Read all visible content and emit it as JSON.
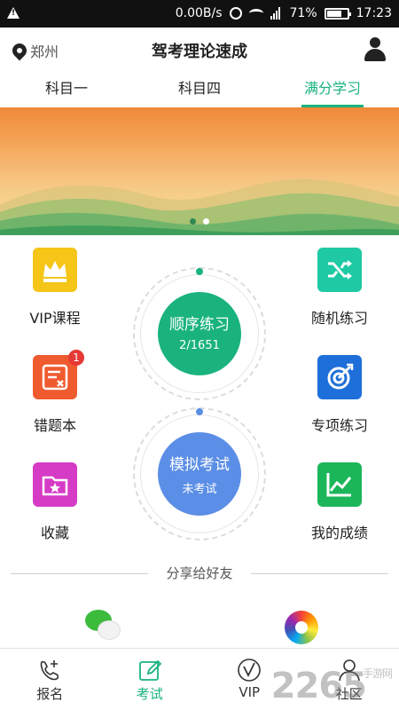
{
  "status_bar": {
    "network_speed": "0.00B/s",
    "battery_percent": "71%",
    "time": "17:23"
  },
  "header": {
    "city": "郑州",
    "title": "驾考理论速成"
  },
  "tabs": [
    {
      "label": "科目一",
      "active": false
    },
    {
      "label": "科目四",
      "active": false
    },
    {
      "label": "满分学习",
      "active": true
    }
  ],
  "banner": {
    "page_count": 2,
    "current_page": 2
  },
  "features": {
    "vip_course": "VIP课程",
    "random_practice": "随机练习",
    "wrong_questions": "错题本",
    "wrong_questions_badge": "1",
    "special_practice": "专项练习",
    "favorites": "收藏",
    "my_scores": "我的成绩"
  },
  "sequential_practice": {
    "label": "顺序练习",
    "progress": "2/1651"
  },
  "mock_exam": {
    "label": "模拟考试",
    "status": "未考试"
  },
  "share": {
    "label": "分享给好友",
    "channels": [
      "wechat-icon",
      "aperture-icon"
    ]
  },
  "bottom_nav": [
    {
      "label": "报名",
      "icon": "phone-plus-icon",
      "active": false
    },
    {
      "label": "考试",
      "icon": "edit-icon",
      "active": true
    },
    {
      "label": "VIP",
      "icon": "vip-icon",
      "active": false
    },
    {
      "label": "社区",
      "icon": "community-icon",
      "active": false
    }
  ],
  "watermark": {
    "text": "2265",
    "sub": "手游网"
  },
  "colors": {
    "accent": "#1ab37e",
    "sequential_circle": "#1ab37e",
    "mock_circle": "#5b8ee6",
    "vip_icon": "#f5c518",
    "random_icon": "#1ec9a4",
    "wrong_icon": "#ef5a2f",
    "special_icon": "#1e6fd9",
    "favorites_icon": "#d63bc5",
    "scores_icon": "#1cb65a"
  }
}
